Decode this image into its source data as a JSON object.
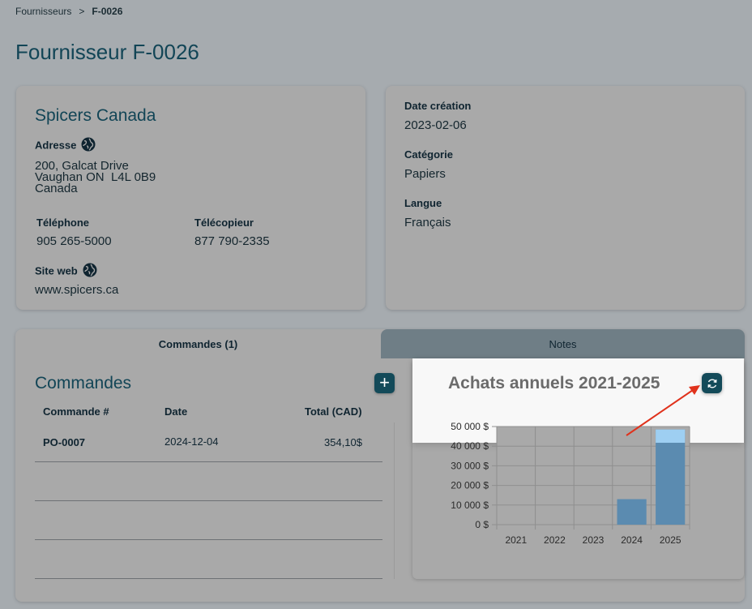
{
  "breadcrumb": {
    "parent": "Fournisseurs",
    "separator": ">",
    "current": "F-0026"
  },
  "page_title": "Fournisseur F-0026",
  "supplier": {
    "name": "Spicers Canada",
    "address_label": "Adresse",
    "address_lines": [
      "200, Galcat Drive",
      "Vaughan ON  L4L 0B9",
      "Canada"
    ],
    "phone_label": "Téléphone",
    "phone": "905 265-5000",
    "fax_label": "Télécopieur",
    "fax": "877 790-2335",
    "website_label": "Site web",
    "website": "www.spicers.ca"
  },
  "details": {
    "created_label": "Date création",
    "created": "2023-02-06",
    "category_label": "Catégorie",
    "category": "Papiers",
    "language_label": "Langue",
    "language": "Français"
  },
  "tabs": [
    {
      "label": "Commandes (1)",
      "active": true
    },
    {
      "label": "Notes",
      "active": false
    }
  ],
  "orders": {
    "title": "Commandes",
    "add_label": "+",
    "columns": [
      "Commande #",
      "Date",
      "Total (CAD)"
    ],
    "rows": [
      {
        "number": "PO-0007",
        "date": "2024-12-04",
        "total": "354,10$"
      }
    ]
  },
  "chart_data": {
    "type": "bar",
    "title": "Achats annuels 2021-2025",
    "categories": [
      "2021",
      "2022",
      "2023",
      "2024",
      "2025"
    ],
    "values": [
      0,
      0,
      0,
      13000,
      48500
    ],
    "ylim": [
      0,
      50000
    ],
    "yticks": [
      0,
      10000,
      20000,
      30000,
      40000,
      50000
    ],
    "ytick_labels": [
      "0 $",
      "10 000 $",
      "20 000 $",
      "30 000 $",
      "40 000 $",
      "50 000 $"
    ],
    "grid": true,
    "legend": "none"
  },
  "colors": {
    "accent": "#134a59",
    "bar": "#5b8bb0",
    "bar_highlight": "#9ecff2",
    "annotation_arrow": "#e0321c"
  },
  "icons": {
    "globe": "globe-icon",
    "refresh": "refresh-icon",
    "add": "plus-icon"
  }
}
